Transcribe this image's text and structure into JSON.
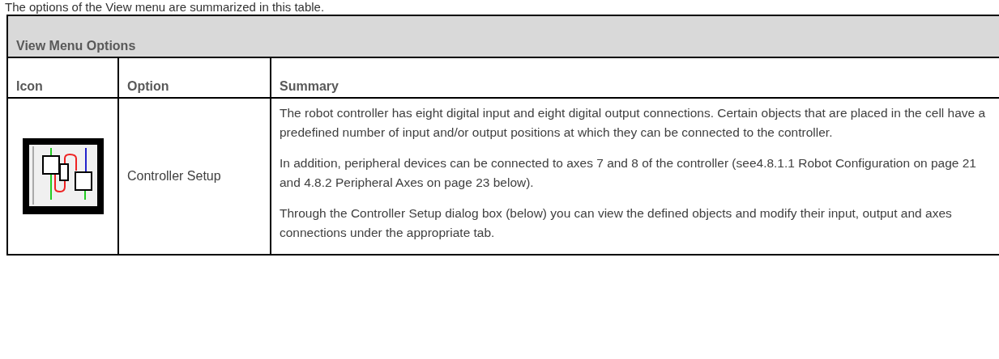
{
  "intro": "The options of the View menu are summarized in this table.",
  "table": {
    "title": "View Menu Options",
    "columns": [
      "Icon",
      "Option",
      "Summary"
    ],
    "rows": [
      {
        "option": "Controller Setup",
        "summary": [
          "The robot controller has eight digital input and eight digital output connections. Certain objects that are placed in the cell have a predefined number of input and/or output positions at which they can be connected to the controller.",
          "In addition, peripheral devices can be connected to axes 7 and 8 of the controller (see4.8.1.1 Robot Configuration on page 21 and 4.8.2 Peripheral Axes on page 23 below).",
          "Through the Controller Setup dialog box (below) you can view the defined objects and modify their input, output and axes connections under the appropriate tab."
        ]
      }
    ]
  }
}
